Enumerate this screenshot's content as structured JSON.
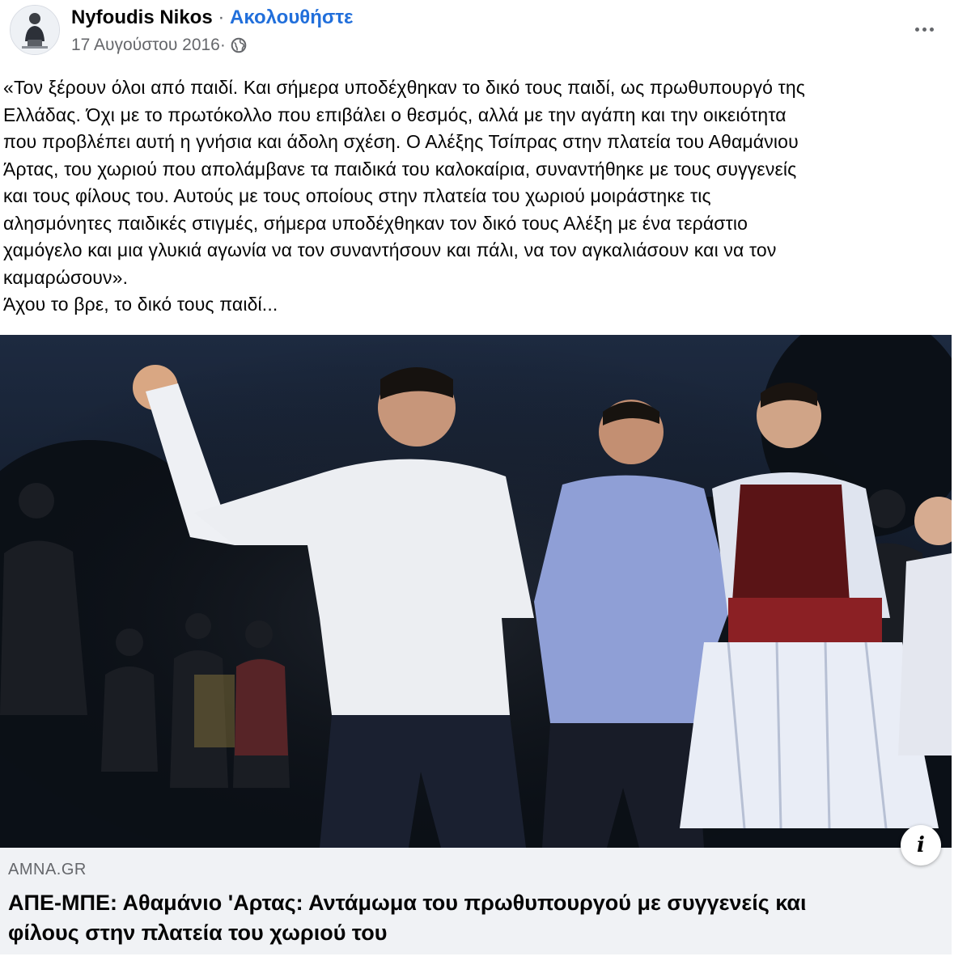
{
  "post": {
    "author": "Nyfoudis Nikos",
    "separator": " · ",
    "follow_label": "Ακολουθήστε",
    "date": "17 Αυγούστου 2016",
    "date_separator": " · ",
    "privacy_icon": "globe-icon",
    "more_icon": "more-options-icon",
    "text_lines": [
      "«Τον ξέρουν όλοι από παιδί. Και σήμερα υποδέχθηκαν το δικό τους παιδί, ως πρωθυπουργό της",
      "Ελλάδας. Όχι με το πρωτόκολλο που επιβάλει ο θεσμός, αλλά με την αγάπη και την οικειότητα",
      "που προβλέπει αυτή η γνήσια και άδολη σχέση. Ο Αλέξης Τσίπρας στην πλατεία του Αθαμάνιου",
      "Άρτας, του χωριού που απολάμβανε τα παιδικά του καλοκαίρια, συναντήθηκε με τους συγγενείς",
      "και τους φίλους του. Αυτούς με τους οποίους στην πλατεία του χωριού μοιράστηκε τις",
      "αλησμόνητες παιδικές στιγμές, σήμερα υποδέχθηκαν τον δικό τους Αλέξη με ένα τεράστιο",
      "χαμόγελο και μια γλυκιά αγωνία να τον συναντήσουν και πάλι, να τον αγκαλιάσουν και να τον",
      "καμαρώσουν».",
      "Άχου το βρε, το δικό τους παιδί..."
    ]
  },
  "link_preview": {
    "info_label": "i",
    "domain": "AMNA.GR",
    "title_lines": [
      "ΑΠΕ-ΜΠΕ: Αθαμάνιο 'Αρτας: Αντάμωμα του πρωθυπουργού με συγγενείς και",
      "φίλους στην πλατεία του χωριού του"
    ]
  },
  "colors": {
    "follow_link": "#216fdb",
    "meta_text": "#65676b",
    "card_background": "#f0f2f5",
    "photo_night_sky": "#121a27"
  }
}
